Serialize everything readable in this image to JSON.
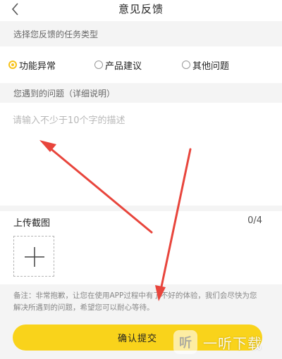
{
  "header": {
    "title": "意见反馈",
    "back_icon": "chevron-left-icon"
  },
  "task_type": {
    "label": "选择您反馈的任务类型",
    "options": [
      {
        "label": "功能异常",
        "selected": true
      },
      {
        "label": "产品建议",
        "selected": false
      },
      {
        "label": "其他问题",
        "selected": false
      }
    ]
  },
  "problem": {
    "label": "您遇到的问题（详细说明）",
    "placeholder": "请输入不少于10个字的描述",
    "value": ""
  },
  "upload": {
    "title": "上传截图",
    "count": "0/4",
    "icon": "plus-icon"
  },
  "note": "备注：非常抱歉，让您在使用APP过程中有了不好的体验，我们会尽快为您解决所遇到的问题，希望您可以耐心等待。",
  "submit_label": "确认提交",
  "watermark": {
    "logo_text": "听",
    "text": "一听下载"
  },
  "colors": {
    "accent": "#f9d31b",
    "annotation_arrow": "#e8453c"
  }
}
